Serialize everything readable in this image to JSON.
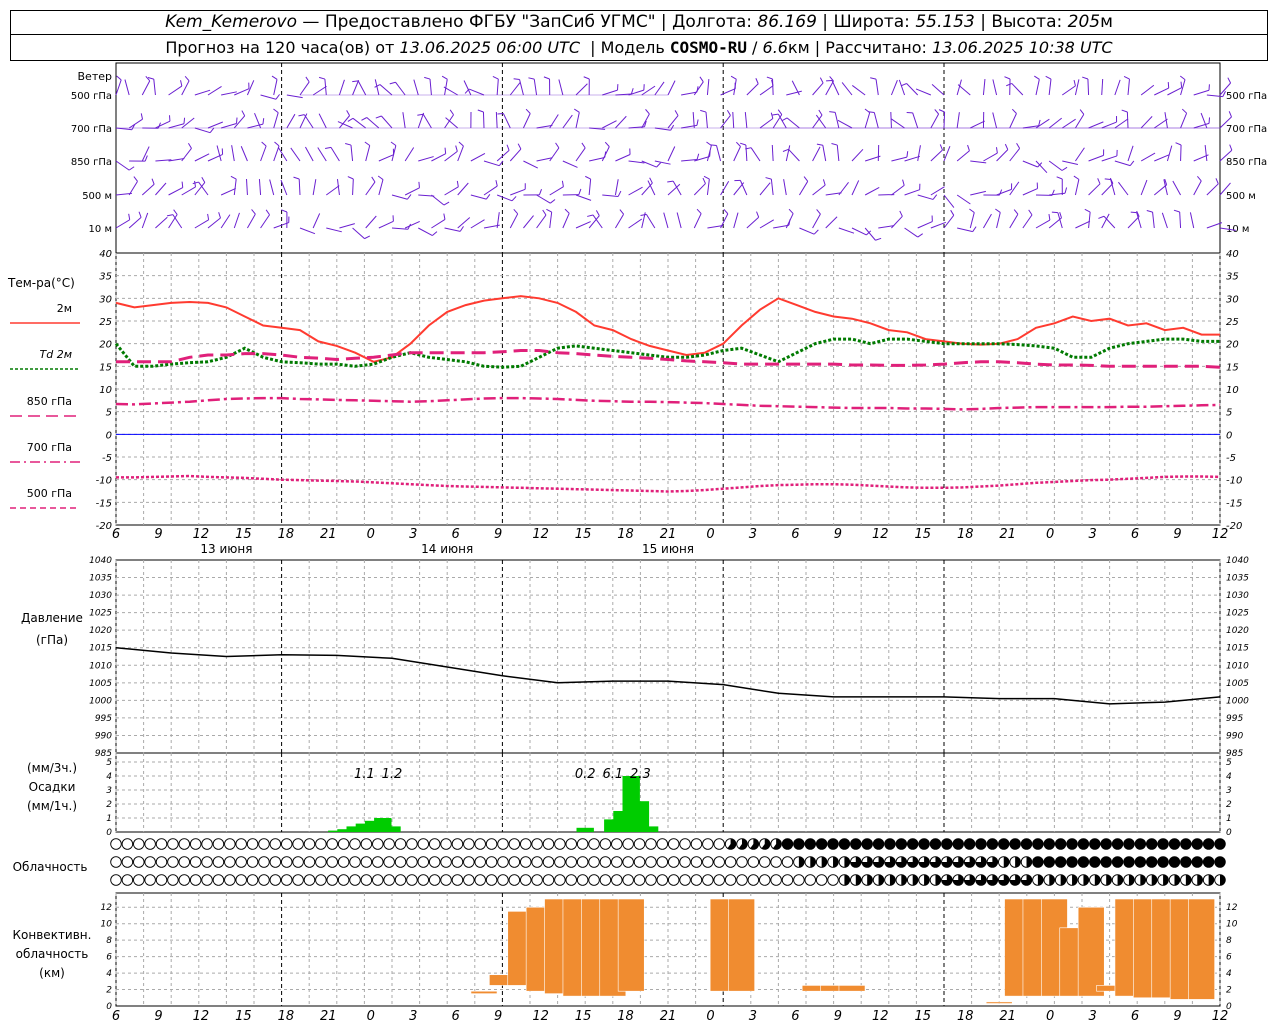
{
  "header": {
    "station": "Kem_Kemerovo",
    "provider": "— Предоставлено ФГБУ \"ЗапСиб УГМС\"",
    "lon_label": "Долгота:",
    "lon": "86.169",
    "lat_label": "Широта:",
    "lat": "55.153",
    "alt_label": "Высота:",
    "alt": "205",
    "alt_unit": "м",
    "forecast_label": "Прогноз на 120 часа(ов) от",
    "forecast_start": "13.06.2025 06:00 UTC",
    "model_label": "Модель",
    "model": "COSMO-RU",
    "resolution": "6.6",
    "resolution_unit": "км",
    "computed_label": "Рассчитано:",
    "computed": "13.06.2025 10:38 UTC"
  },
  "colors": {
    "grid": "#aaaaaa",
    "t2m": "#ff3b30",
    "td": "#007a00",
    "t850": "#e0207a",
    "t700": "#e0207a",
    "t500": "#e0207a",
    "wind": "#6a1fd0",
    "pressure": "#000000",
    "precip": "#00cc00",
    "conv": "#f08c30",
    "zero": "#0000ff"
  },
  "time_axis": {
    "hour_labels": [
      "6",
      "9",
      "12",
      "15",
      "18",
      "21",
      "0",
      "3",
      "6",
      "9",
      "12",
      "15",
      "18",
      "21",
      "0",
      "3",
      "6",
      "9",
      "12",
      "15",
      "18",
      "21",
      "0",
      "3",
      "6",
      "9",
      "12"
    ],
    "day_labels": [
      {
        "label": "13 июня",
        "hour": 12
      },
      {
        "label": "14 июня",
        "hour": 36
      },
      {
        "label": "15 июня",
        "hour": 60
      }
    ]
  },
  "wind_panel": {
    "title": "Ветер",
    "levels": [
      "500 гПа",
      "700 гПа",
      "850 гПа",
      "500 м",
      "10 м"
    ]
  },
  "temp_panel": {
    "ylabel": "Тем-ра(°C)",
    "legend": [
      {
        "label": "2м",
        "style": "solid",
        "color": "#ff3b30"
      },
      {
        "label": "Td 2м",
        "style": "dotted",
        "color": "#007a00"
      },
      {
        "label": "850 гПа",
        "style": "long-dash",
        "color": "#e0207a"
      },
      {
        "label": "700 гПа",
        "style": "dash-dot",
        "color": "#e0207a"
      },
      {
        "label": "500 гПа",
        "style": "dashed",
        "color": "#e0207a"
      }
    ],
    "ticks": [
      "40",
      "35",
      "30",
      "25",
      "20",
      "15",
      "10",
      "5",
      "0",
      "-5",
      "-10",
      "-15",
      "-20"
    ]
  },
  "pressure_panel": {
    "ylabel1": "Давление",
    "ylabel2": "(гПа)",
    "ticks": [
      "1040",
      "1035",
      "1030",
      "1025",
      "1020",
      "1015",
      "1010",
      "1005",
      "1000",
      "995",
      "990",
      "985"
    ]
  },
  "precip_panel": {
    "ylabel1": "(мм/3ч.)",
    "ylabel2": "Осадки",
    "ylabel3": "(мм/1ч.)",
    "ticks": [
      "5",
      "4",
      "3",
      "2",
      "1",
      "0"
    ],
    "totals": [
      {
        "hour": 27,
        "label": "1.1"
      },
      {
        "hour": 30,
        "label": "1.2"
      },
      {
        "hour": 51,
        "label": "0.2"
      },
      {
        "hour": 54,
        "label": "6.1"
      },
      {
        "hour": 57,
        "label": "2.3"
      }
    ]
  },
  "cloud_panel": {
    "ylabel": "Облачность"
  },
  "conv_panel": {
    "ylabel1": "Конвективн.",
    "ylabel2": "облачность",
    "ylabel3": "(км)",
    "ticks": [
      "12",
      "10",
      "8",
      "6",
      "4",
      "2",
      "0"
    ]
  },
  "chart_data": [
    {
      "type": "line",
      "title": "Ветер",
      "series": [],
      "levels": [
        "500 гПа",
        "700 гПа",
        "850 гПа",
        "500 м",
        "10 м"
      ]
    },
    {
      "type": "line",
      "ylabel": "Тем-ра(°C)",
      "ylim": [
        -20,
        40
      ],
      "x_hours": [
        0,
        2,
        4,
        6,
        8,
        10,
        12,
        14,
        16,
        18,
        20,
        22,
        24,
        26,
        28,
        30,
        32,
        34,
        36,
        38,
        40,
        42,
        44,
        46,
        48,
        50,
        52,
        54,
        56,
        58,
        60,
        62,
        64,
        66,
        68,
        70,
        72,
        74,
        76,
        78,
        80,
        82,
        84,
        86,
        88,
        90,
        92,
        94,
        96,
        98,
        100,
        102,
        104,
        106,
        108,
        110,
        112,
        114,
        116,
        118,
        120
      ],
      "series": [
        {
          "name": "2м",
          "values": [
            29,
            28,
            28.5,
            29,
            29.2,
            29,
            28,
            26,
            24,
            23.5,
            23,
            20.5,
            19.5,
            18,
            16,
            17,
            20,
            24,
            27,
            28.5,
            29.5,
            30,
            30.5,
            30,
            29,
            27,
            24,
            23,
            21,
            19.5,
            18.5,
            17.5,
            18,
            20,
            24,
            27.5,
            30,
            28.5,
            27,
            26,
            25.5,
            24.5,
            23,
            22.5,
            21,
            20.5,
            20,
            19.8,
            20,
            21,
            23.5,
            24.5,
            26,
            25,
            25.5,
            24,
            24.5,
            23,
            23.5,
            22,
            22
          ]
        },
        {
          "name": "Td 2м",
          "values": [
            20,
            15,
            15,
            15.5,
            15.8,
            16,
            17,
            19,
            17,
            16,
            15.8,
            15.5,
            15.5,
            15,
            15.5,
            17,
            18,
            17,
            16.5,
            16,
            15,
            14.8,
            15,
            17,
            19,
            19.5,
            19,
            18.5,
            18,
            17.5,
            17,
            17,
            17.5,
            18.5,
            19,
            17.5,
            16,
            18,
            20,
            21,
            21,
            20,
            21,
            21,
            20.5,
            20,
            20,
            20,
            20,
            19.8,
            19.5,
            19,
            17,
            17,
            19,
            20,
            20.5,
            21,
            21,
            20.5,
            20.5
          ]
        },
        {
          "name": "850 гПа",
          "values": [
            16,
            16,
            16,
            16,
            17,
            17.5,
            17.5,
            17.8,
            17.8,
            17.5,
            17,
            16.8,
            16.5,
            16.8,
            17,
            17.5,
            18,
            18,
            18,
            18,
            18,
            18.2,
            18.5,
            18.5,
            18,
            17.8,
            17.5,
            17.2,
            17,
            16.8,
            16.5,
            16.2,
            16,
            15.8,
            15.5,
            15.5,
            15.5,
            15.5,
            15.5,
            15.5,
            15.3,
            15.3,
            15.2,
            15.2,
            15.3,
            15.5,
            15.8,
            16,
            16,
            15.8,
            15.5,
            15.3,
            15.3,
            15.2,
            15,
            15,
            15,
            15,
            15,
            15,
            14.8
          ]
        },
        {
          "name": "700 гПа",
          "values": [
            6.7,
            6.6,
            6.8,
            7,
            7.2,
            7.5,
            7.8,
            7.9,
            8,
            8,
            7.8,
            7.7,
            7.6,
            7.5,
            7.4,
            7.3,
            7.2,
            7.3,
            7.5,
            7.7,
            7.9,
            8,
            8,
            7.9,
            7.8,
            7.6,
            7.4,
            7.3,
            7.2,
            7.2,
            7.1,
            7,
            6.9,
            6.7,
            6.5,
            6.3,
            6.2,
            6.1,
            6,
            5.9,
            5.8,
            5.8,
            5.8,
            5.7,
            5.7,
            5.6,
            5.5,
            5.6,
            5.8,
            5.9,
            6,
            6,
            6,
            6,
            6,
            6.1,
            6.1,
            6.2,
            6.3,
            6.4,
            6.5
          ]
        },
        {
          "name": "500 гПа",
          "values": [
            -9.5,
            -9.5,
            -9.4,
            -9.3,
            -9.2,
            -9.4,
            -9.5,
            -9.6,
            -9.8,
            -10,
            -10.1,
            -10.2,
            -10.3,
            -10.4,
            -10.6,
            -10.8,
            -11,
            -11.2,
            -11.4,
            -11.5,
            -11.6,
            -11.7,
            -11.8,
            -11.9,
            -12,
            -12.1,
            -12.2,
            -12.3,
            -12.4,
            -12.5,
            -12.6,
            -12.5,
            -12.3,
            -12,
            -11.7,
            -11.4,
            -11.2,
            -11.1,
            -11,
            -11,
            -11.1,
            -11.3,
            -11.5,
            -11.7,
            -11.8,
            -11.8,
            -11.7,
            -11.5,
            -11.3,
            -11,
            -10.7,
            -10.5,
            -10.3,
            -10.1,
            -10,
            -9.8,
            -9.6,
            -9.4,
            -9.3,
            -9.3,
            -9.4
          ]
        }
      ]
    },
    {
      "type": "line",
      "ylabel": "Давление (гПа)",
      "ylim": [
        985,
        1040
      ],
      "x_hours": [
        0,
        6,
        12,
        18,
        24,
        30,
        36,
        42,
        48,
        54,
        60,
        66,
        72,
        78,
        84,
        90,
        96,
        102,
        108,
        114,
        120
      ],
      "series": [
        {
          "name": "Давление",
          "values": [
            1015,
            1013.5,
            1012.5,
            1013,
            1012.8,
            1012,
            1009.5,
            1007,
            1005,
            1005.5,
            1005.5,
            1004.5,
            1002,
            1001,
            1001,
            1001,
            1000.5,
            1000.5,
            999,
            999.5,
            1001
          ]
        }
      ]
    },
    {
      "type": "bar",
      "ylabel": "Осадки (мм/1ч.)",
      "ylim": [
        0,
        5
      ],
      "x_hours": [
        24,
        25,
        26,
        27,
        28,
        29,
        30,
        31,
        32,
        51,
        52,
        53,
        54,
        55,
        56,
        57,
        58
      ],
      "values": [
        0.1,
        0.2,
        0.4,
        0.6,
        0.8,
        1.0,
        0.4,
        0,
        0,
        0.3,
        0,
        0,
        0.9,
        1.5,
        4.0,
        2.2,
        0.4
      ]
    },
    {
      "type": "bar",
      "ylabel": "Конвективн. облачность (км)",
      "ylim": [
        0,
        13
      ],
      "x_hours": [
        20,
        21,
        22,
        23,
        24,
        25,
        26,
        27,
        28,
        33,
        34,
        38,
        39,
        40,
        48,
        49,
        50,
        51,
        52,
        53,
        54,
        55,
        56,
        57,
        58,
        59
      ],
      "top": [
        1.8,
        3.8,
        11.5,
        12,
        13,
        13,
        13,
        13,
        13,
        13,
        13,
        2.5,
        2.5,
        2.5,
        0.5,
        13,
        13,
        13,
        9.5,
        12,
        2.5,
        13,
        13,
        13,
        13,
        13
      ],
      "bottom": [
        1.5,
        2.5,
        2.5,
        1.8,
        1.5,
        1.2,
        1.2,
        1.2,
        1.8,
        1.8,
        1.8,
        1.8,
        1.8,
        1.8,
        0.3,
        1.2,
        1.2,
        1.2,
        1.2,
        1.2,
        1.8,
        1.2,
        1.0,
        1.0,
        0.8,
        0.8
      ]
    }
  ]
}
